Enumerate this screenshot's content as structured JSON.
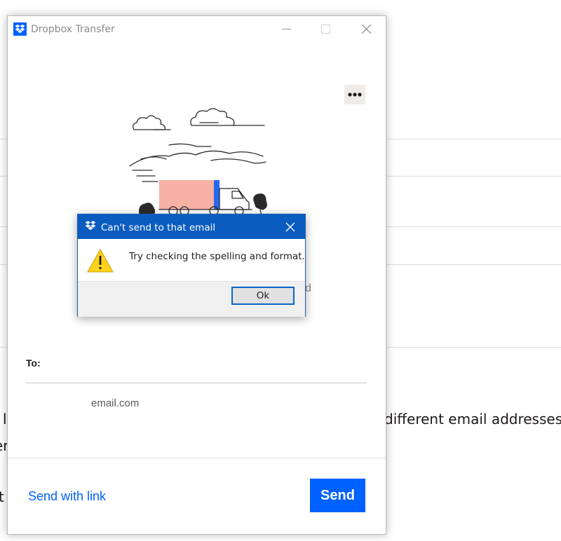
{
  "background": {
    "text_1": "l",
    "text_2": "different email addresses",
    "text_3": "er",
    "text_4": "t"
  },
  "window": {
    "title": "Dropbox Transfer",
    "app_icon": "dropbox-logo",
    "controls": [
      "minimize",
      "maximize",
      "close"
    ],
    "more_button_icon": "ellipsis-horizontal",
    "behind_dialog_text": "d",
    "to_label": "To:",
    "recipient_email": "email.com",
    "send_with_link_label": "Send with link",
    "send_button_label": "Send",
    "accent_color": "#0061fe"
  },
  "dialog": {
    "title": "Can't send to that email",
    "message": "Try checking the spelling and format.",
    "ok_label": "Ok",
    "icon": "warning-triangle",
    "titlebar_color": "#0a5cbf"
  }
}
